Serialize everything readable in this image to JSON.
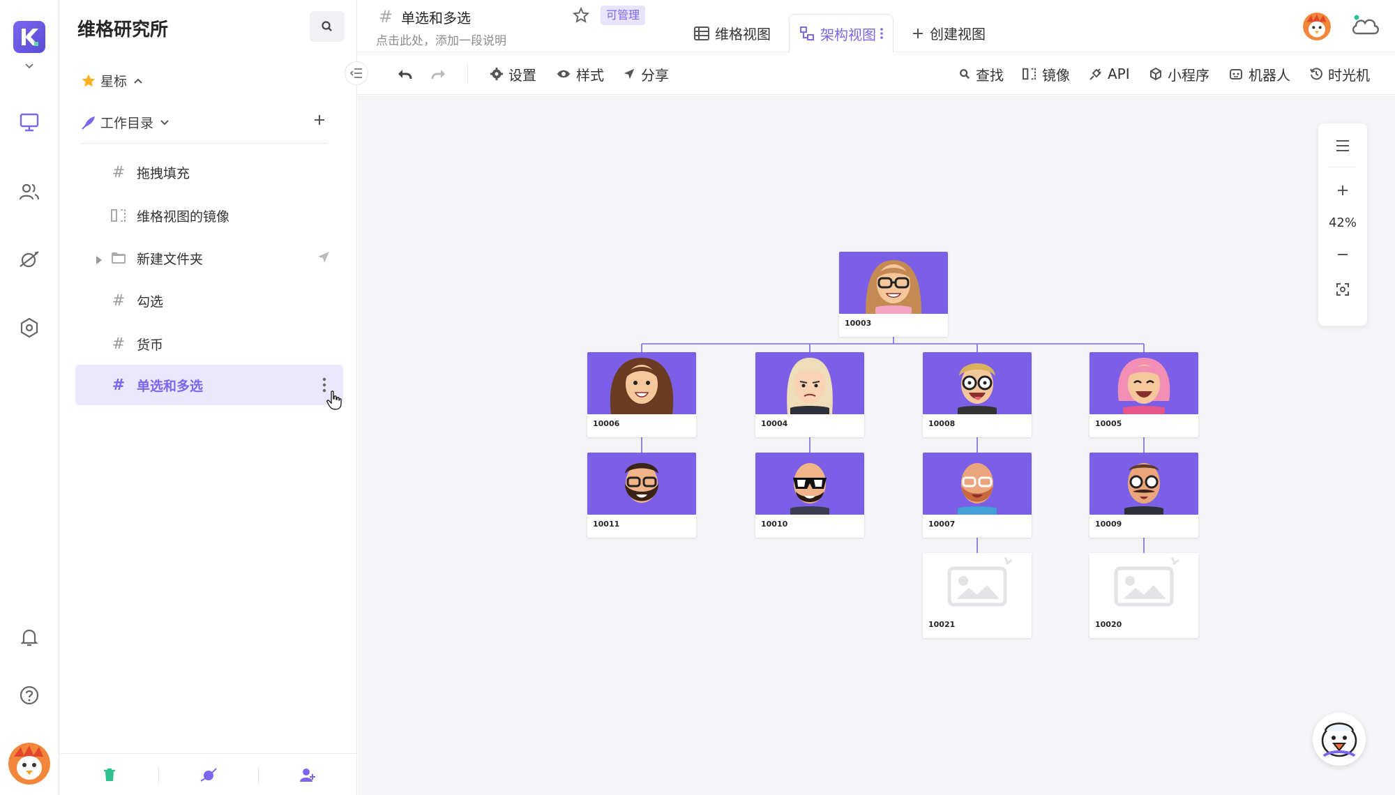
{
  "sidebar": {
    "space_name": "维格研究所",
    "starred_label": "星标",
    "catalog_label": "工作目录",
    "nodes": [
      {
        "label": "拖拽填充",
        "icon": "hash-icon"
      },
      {
        "label": "维格视图的镜像",
        "icon": "mirror-icon"
      },
      {
        "label": "新建文件夹",
        "icon": "folder-icon"
      },
      {
        "label": "勾选",
        "icon": "hash-icon"
      },
      {
        "label": "货币",
        "icon": "hash-icon"
      },
      {
        "label": "单选和多选",
        "icon": "hash-icon",
        "active": true
      }
    ]
  },
  "header": {
    "datasheet_name": "单选和多选",
    "description_placeholder": "点击此处，添加一段说明",
    "permission_badge": "可管理",
    "tabs": [
      {
        "label": "维格视图",
        "icon": "grid-view-icon"
      },
      {
        "label": "架构视图",
        "icon": "org-view-icon",
        "active": true
      },
      {
        "label": "创建视图",
        "icon": "plus-icon"
      }
    ]
  },
  "toolbar": {
    "settings": "设置",
    "style": "样式",
    "share": "分享",
    "find": "查找",
    "mirror": "镜像",
    "api": "API",
    "mini_program": "小程序",
    "robot": "机器人",
    "time_machine": "时光机"
  },
  "canvas": {
    "zoom": "42%",
    "org_cards": {
      "root": "10003",
      "level1": [
        "10006",
        "10004",
        "10008",
        "10005"
      ],
      "level2": [
        "10011",
        "10010",
        "10007",
        "10009"
      ],
      "level3": [
        "10021",
        "10020"
      ]
    }
  },
  "colors": {
    "accent": "#7b67ee",
    "card_image_bg": "#7b5fe6",
    "connector": "#7b67ee"
  }
}
